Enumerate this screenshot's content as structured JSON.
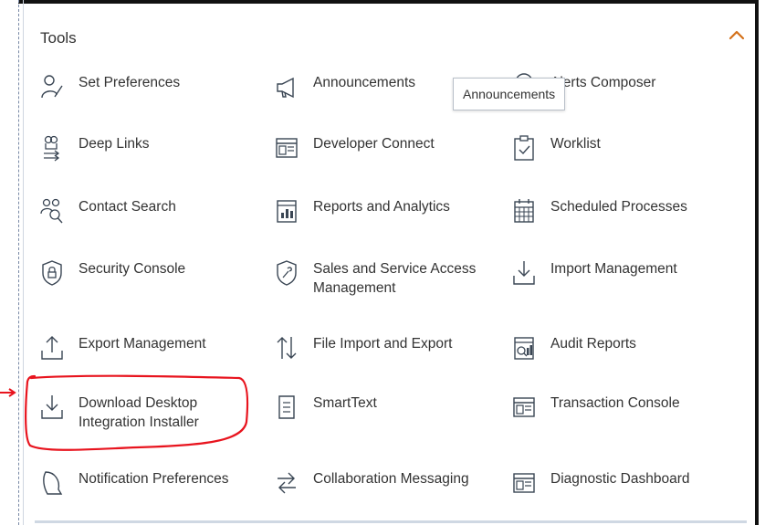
{
  "panel": {
    "title": "Tools"
  },
  "tooltip": {
    "text": "Announcements"
  },
  "items": {
    "set_preferences": "Set Preferences",
    "announcements": "Announcements",
    "alerts_composer": "Alerts Composer",
    "deep_links": "Deep Links",
    "developer_connect": "Developer Connect",
    "worklist": "Worklist",
    "contact_search": "Contact Search",
    "reports_analytics": "Reports and Analytics",
    "scheduled_processes": "Scheduled Processes",
    "security_console": "Security Console",
    "sales_service_access": "Sales and Service Access Management",
    "import_management": "Import Management",
    "export_management": "Export Management",
    "file_import_export": "File Import and Export",
    "audit_reports": "Audit Reports",
    "download_desktop_integration": "Download Desktop Integration Installer",
    "smarttext": "SmartText",
    "transaction_console": "Transaction Console",
    "notification_preferences": "Notification Preferences",
    "collaboration_messaging": "Collaboration Messaging",
    "diagnostic_dashboard": "Diagnostic Dashboard"
  },
  "colors": {
    "accent": "#d4711a",
    "icon": "#3a4654",
    "highlight": "#e8141e",
    "text": "#333333"
  }
}
